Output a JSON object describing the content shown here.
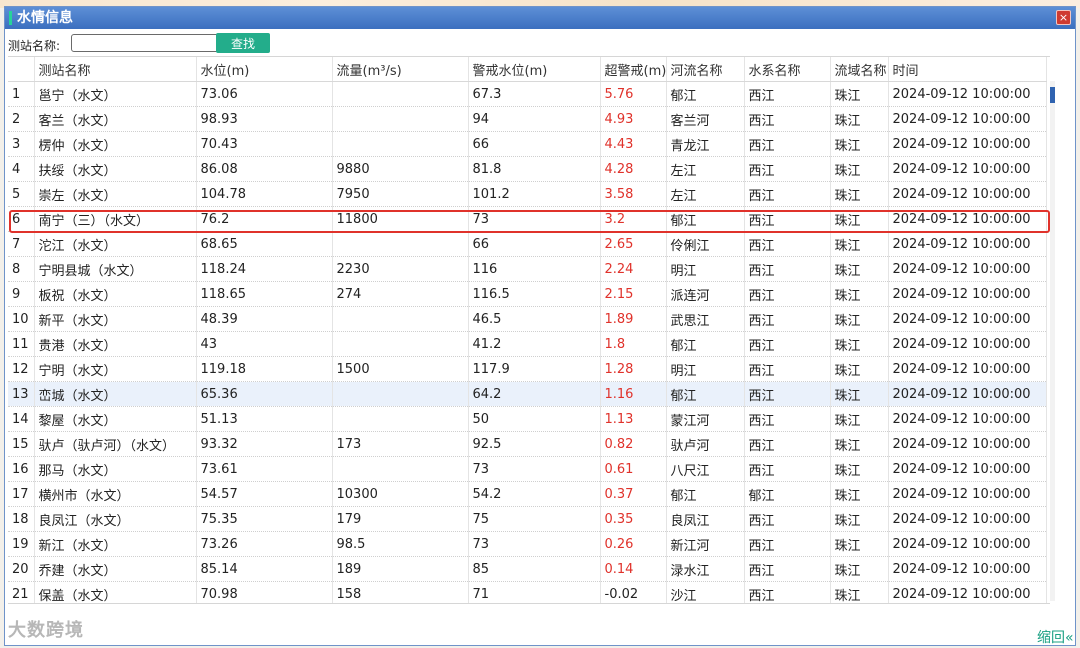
{
  "window": {
    "title": "水情信息",
    "close_label": "×"
  },
  "search": {
    "label": "测站名称:",
    "value": "",
    "placeholder": "",
    "button_label": "查找"
  },
  "table": {
    "columns": [
      "",
      "测站名称",
      "水位(m)",
      "流量(m³/s)",
      "警戒水位(m)",
      "超警戒(m)",
      "河流名称",
      "水系名称",
      "流域名称",
      "时间"
    ],
    "rows": [
      [
        "1",
        "邕宁（水文）",
        "73.06",
        "",
        "67.3",
        "5.76",
        "郁江",
        "西江",
        "珠江",
        "2024-09-12 10:00:00"
      ],
      [
        "2",
        "客兰（水文）",
        "98.93",
        "",
        "94",
        "4.93",
        "客兰河",
        "西江",
        "珠江",
        "2024-09-12 10:00:00"
      ],
      [
        "3",
        "楞仲（水文）",
        "70.43",
        "",
        "66",
        "4.43",
        "青龙江",
        "西江",
        "珠江",
        "2024-09-12 10:00:00"
      ],
      [
        "4",
        "扶绥（水文）",
        "86.08",
        "9880",
        "81.8",
        "4.28",
        "左江",
        "西江",
        "珠江",
        "2024-09-12 10:00:00"
      ],
      [
        "5",
        "崇左（水文）",
        "104.78",
        "7950",
        "101.2",
        "3.58",
        "左江",
        "西江",
        "珠江",
        "2024-09-12 10:00:00"
      ],
      [
        "6",
        "南宁（三）（水文）",
        "76.2",
        "11800",
        "73",
        "3.2",
        "郁江",
        "西江",
        "珠江",
        "2024-09-12 10:00:00"
      ],
      [
        "7",
        "沱江（水文）",
        "68.65",
        "",
        "66",
        "2.65",
        "伶俐江",
        "西江",
        "珠江",
        "2024-09-12 10:00:00"
      ],
      [
        "8",
        "宁明县城（水文）",
        "118.24",
        "2230",
        "116",
        "2.24",
        "明江",
        "西江",
        "珠江",
        "2024-09-12 10:00:00"
      ],
      [
        "9",
        "板祝（水文）",
        "118.65",
        "274",
        "116.5",
        "2.15",
        "派连河",
        "西江",
        "珠江",
        "2024-09-12 10:00:00"
      ],
      [
        "10",
        "新平（水文）",
        "48.39",
        "",
        "46.5",
        "1.89",
        "武思江",
        "西江",
        "珠江",
        "2024-09-12 10:00:00"
      ],
      [
        "11",
        "贵港（水文）",
        "43",
        "",
        "41.2",
        "1.8",
        "郁江",
        "西江",
        "珠江",
        "2024-09-12 10:00:00"
      ],
      [
        "12",
        "宁明（水文）",
        "119.18",
        "1500",
        "117.9",
        "1.28",
        "明江",
        "西江",
        "珠江",
        "2024-09-12 10:00:00"
      ],
      [
        "13",
        "峦城（水文）",
        "65.36",
        "",
        "64.2",
        "1.16",
        "郁江",
        "西江",
        "珠江",
        "2024-09-12 10:00:00"
      ],
      [
        "14",
        "黎屋（水文）",
        "51.13",
        "",
        "50",
        "1.13",
        "蒙江河",
        "西江",
        "珠江",
        "2024-09-12 10:00:00"
      ],
      [
        "15",
        "驮卢（驮卢河）（水文）",
        "93.32",
        "173",
        "92.5",
        "0.82",
        "驮卢河",
        "西江",
        "珠江",
        "2024-09-12 10:00:00"
      ],
      [
        "16",
        "那马（水文）",
        "73.61",
        "",
        "73",
        "0.61",
        "八尺江",
        "西江",
        "珠江",
        "2024-09-12 10:00:00"
      ],
      [
        "17",
        "横州市（水文）",
        "54.57",
        "10300",
        "54.2",
        "0.37",
        "郁江",
        "郁江",
        "珠江",
        "2024-09-12 10:00:00"
      ],
      [
        "18",
        "良凤江（水文）",
        "75.35",
        "179",
        "75",
        "0.35",
        "良凤江",
        "西江",
        "珠江",
        "2024-09-12 10:00:00"
      ],
      [
        "19",
        "新江（水文）",
        "73.26",
        "98.5",
        "73",
        "0.26",
        "新江河",
        "西江",
        "珠江",
        "2024-09-12 10:00:00"
      ],
      [
        "20",
        "乔建（水文）",
        "85.14",
        "189",
        "85",
        "0.14",
        "渌水江",
        "西江",
        "珠江",
        "2024-09-12 10:00:00"
      ],
      [
        "21",
        "保盖（水文）",
        "70.98",
        "158",
        "71",
        "-0.02",
        "沙江",
        "西江",
        "珠江",
        "2024-09-12 10:00:00"
      ]
    ],
    "highlighted_row": 6,
    "selected_row": 13
  },
  "footer": {
    "collapse_label": "缩回«",
    "watermark": "大数跨境"
  },
  "colors": {
    "accent": "#23ad8b",
    "title_bar": "#3b6fbf",
    "alert_red": "#e0322b",
    "highlight_border": "#e0322b"
  }
}
